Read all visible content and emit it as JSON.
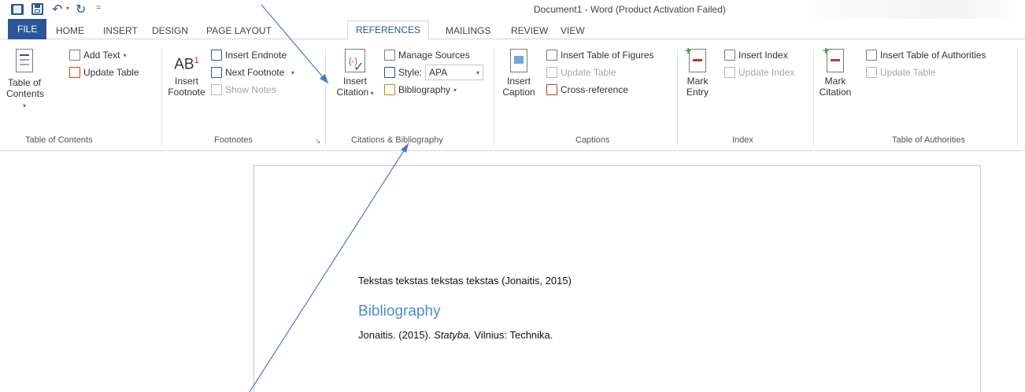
{
  "title": "Document1 - Word (Product Activation Failed)",
  "quick_access": {
    "undo_label": "",
    "redo_label": ""
  },
  "tabs": {
    "file": "FILE",
    "home": "HOME",
    "insert": "INSERT",
    "design": "DESIGN",
    "page_layout": "PAGE LAYOUT",
    "references": "REFERENCES",
    "mailings": "MAILINGS",
    "review": "REVIEW",
    "view": "VIEW"
  },
  "ribbon": {
    "toc": {
      "big_label_1": "Table of",
      "big_label_2": "Contents",
      "add_text": "Add Text",
      "update_table": "Update Table",
      "group_label": "Table of Contents"
    },
    "footnotes": {
      "big_glyph": "AB",
      "big_sup": "1",
      "big_label_1": "Insert",
      "big_label_2": "Footnote",
      "insert_endnote": "Insert Endnote",
      "next_footnote": "Next Footnote",
      "show_notes": "Show Notes",
      "group_label": "Footnotes"
    },
    "citations": {
      "big_label_1": "Insert",
      "big_label_2": "Citation",
      "manage_sources": "Manage Sources",
      "style_label": "Style:",
      "style_value": "APA",
      "bibliography": "Bibliography",
      "group_label": "Citations & Bibliography"
    },
    "captions": {
      "big_label_1": "Insert",
      "big_label_2": "Caption",
      "insert_table_of_figures": "Insert Table of Figures",
      "update_table": "Update Table",
      "cross_reference": "Cross-reference",
      "group_label": "Captions"
    },
    "index": {
      "big_label_1": "Mark",
      "big_label_2": "Entry",
      "insert_index": "Insert Index",
      "update_index": "Update Index",
      "group_label": "Index"
    },
    "authorities": {
      "big_label_1": "Mark",
      "big_label_2": "Citation",
      "insert_table_of_authorities": "Insert Table of Authorities",
      "update_table": "Update Table",
      "group_label": "Table of Authorities"
    }
  },
  "document": {
    "body_text": "Tekstas tekstas tekstas tekstas (Jonaitis, 2015)",
    "bib_heading": "Bibliography",
    "bib_entry_prefix": "Jonaitis. (2015). ",
    "bib_entry_title": "Statyba.",
    "bib_entry_suffix": " Vilnius: Technika."
  },
  "colors": {
    "accent": "#2b579a",
    "heading": "#4a8fd0",
    "arrow": "#4a78c8"
  }
}
